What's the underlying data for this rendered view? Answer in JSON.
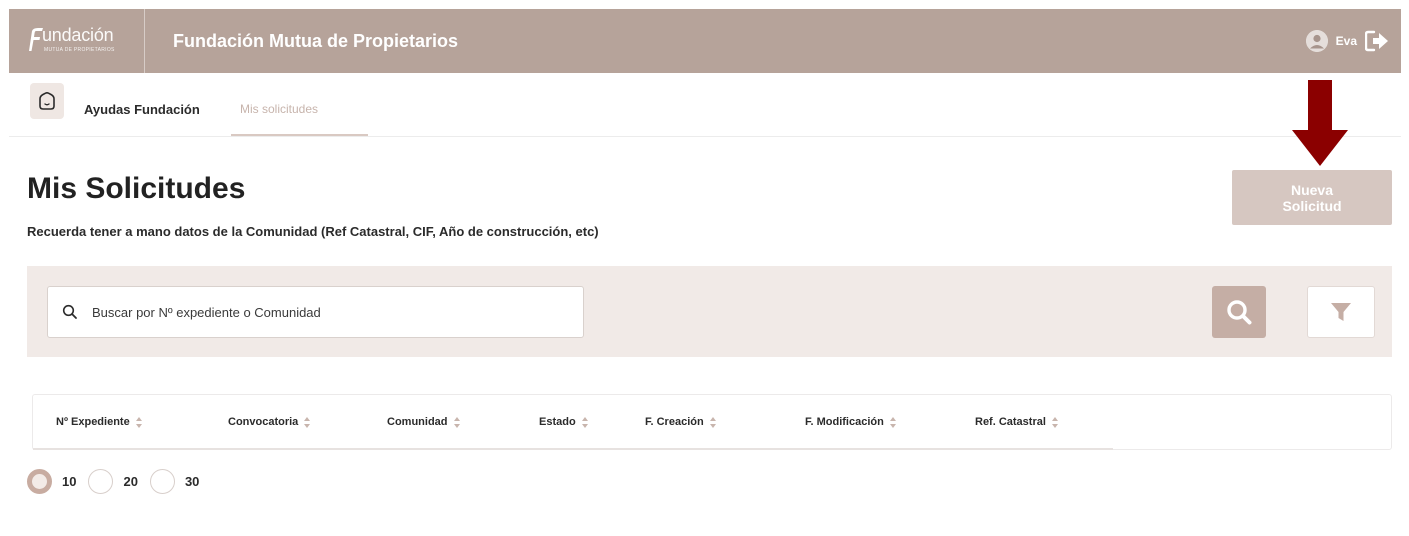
{
  "header": {
    "logo_word": "undación",
    "logo_sub": "MUTUA DE PROPIETARIOS",
    "title": "Fundación Mutua de Propietarios",
    "user_name": "Eva"
  },
  "subnav": {
    "crumb": "Ayudas Fundación",
    "tab": "Mis solicitudes"
  },
  "main": {
    "title": "Mis Solicitudes",
    "subtitle": "Recuerda tener a mano datos de la Comunidad (Ref Catastral, CIF, Año de construcción, etc)",
    "new_button": "Nueva Solicitud"
  },
  "search": {
    "placeholder": "Buscar por Nº expediente o Comunidad"
  },
  "table": {
    "columns": [
      "Nº Expediente",
      "Convocatoria",
      "Comunidad",
      "Estado",
      "F. Creación",
      "F. Modificación",
      "Ref. Catastral"
    ]
  },
  "pager": {
    "options": [
      "10",
      "20",
      "30"
    ],
    "selected": "10"
  },
  "colors": {
    "header": "#b6a39a",
    "accent": "#c5aea5",
    "filter_bg": "#f1eae7",
    "arrow": "#8b0000"
  },
  "icons": [
    "house-icon",
    "user-avatar-icon",
    "logout-icon",
    "search-icon",
    "filter-icon",
    "sort-icon",
    "arrow-down-icon"
  ]
}
